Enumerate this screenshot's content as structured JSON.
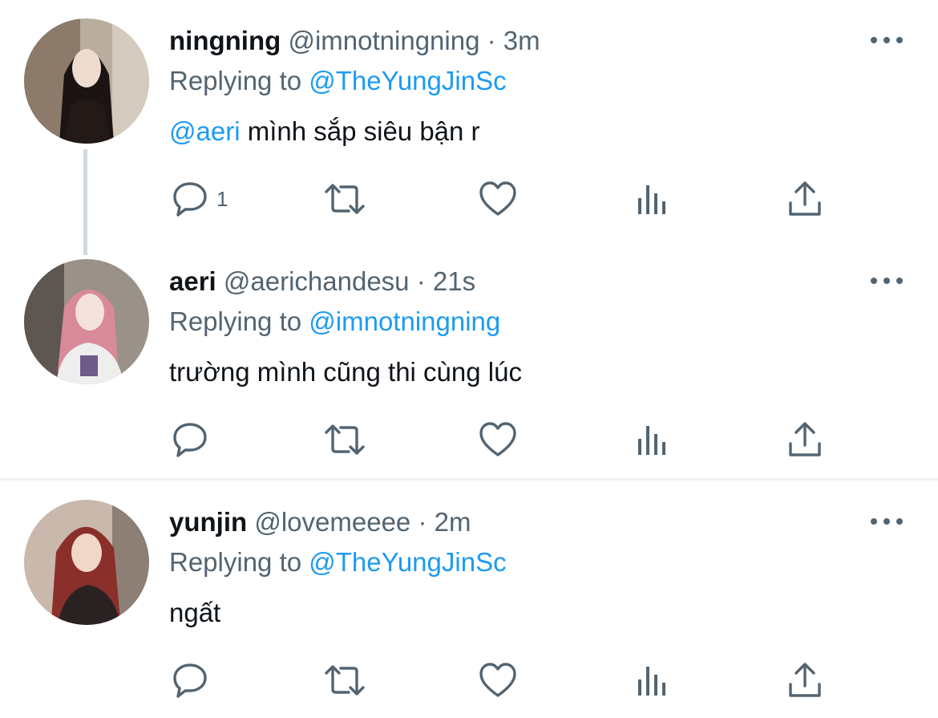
{
  "tweets": [
    {
      "name": "ningning",
      "handle": "@imnotningning",
      "dot": "·",
      "time": "3m",
      "replying_prefix": "Replying to ",
      "replying_to": "@TheYungJinSc",
      "mention": "@aeri",
      "text": " mình sắp siêu bận r",
      "reply_count": "1"
    },
    {
      "name": "aeri",
      "handle": "@aerichandesu",
      "dot": "·",
      "time": "21s",
      "replying_prefix": "Replying to ",
      "replying_to": "@imnotningning",
      "mention": "",
      "text": "trường mình cũng thi cùng lúc",
      "reply_count": ""
    },
    {
      "name": "yunjin",
      "handle": "@lovemeeee",
      "dot": "·",
      "time": "2m",
      "replying_prefix": "Replying to ",
      "replying_to": "@TheYungJinSc",
      "mention": "",
      "text": "ngất",
      "reply_count": ""
    }
  ],
  "icons": [
    "reply-icon",
    "retweet-icon",
    "like-icon",
    "views-icon",
    "share-icon",
    "more-icon"
  ],
  "colors": {
    "accent": "#1d9bf0",
    "secondary": "#536471",
    "text": "#0f1419",
    "thread_line": "#cfd9de"
  }
}
